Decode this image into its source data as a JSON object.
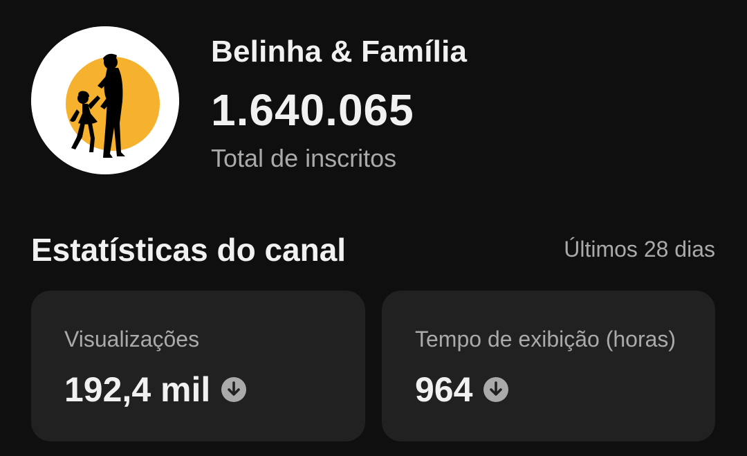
{
  "channel": {
    "name": "Belinha & Família",
    "subscriber_count": "1.640.065",
    "subscriber_label": "Total de inscritos",
    "avatar_icon": "parent-child-silhouette-icon",
    "avatar_colors": {
      "background": "#ffffff",
      "sun": "#f6b12e",
      "silhouette": "#000000"
    }
  },
  "stats": {
    "title": "Estatísticas do canal",
    "period": "Últimos 28 dias",
    "cards": [
      {
        "label": "Visualizações",
        "value": "192,4 mil",
        "trend_icon": "arrow-down-circle-icon",
        "trend": "down"
      },
      {
        "label": "Tempo de exibição (horas)",
        "value": "964",
        "trend_icon": "arrow-down-circle-icon",
        "trend": "down"
      }
    ]
  },
  "colors": {
    "background": "#0f0f0f",
    "card_background": "#212121",
    "primary_text": "#f1f1f1",
    "secondary_text": "#aaaaaa",
    "trend_icon": "#aaaaaa"
  }
}
